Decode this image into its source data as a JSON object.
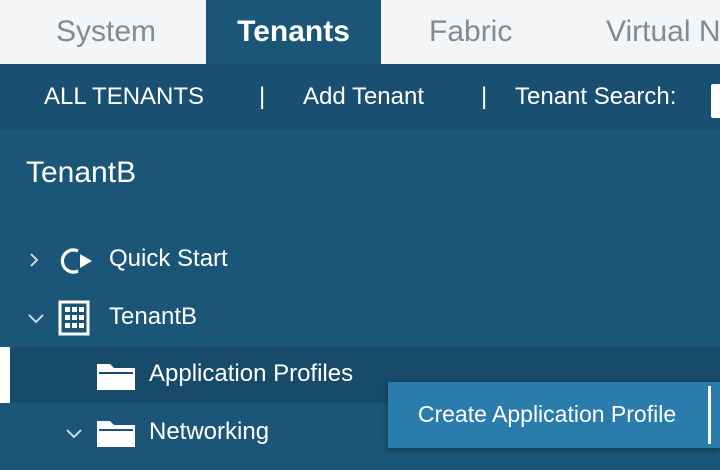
{
  "tabs": [
    {
      "label": "System"
    },
    {
      "label": "Tenants",
      "active": true
    },
    {
      "label": "Fabric"
    },
    {
      "label": "Virtual N"
    }
  ],
  "subnav": {
    "all_tenants": "ALL TENANTS",
    "sep": "|",
    "add_tenant": "Add Tenant",
    "tenant_search": "Tenant Search:"
  },
  "tenant_title": "TenantB",
  "tree": [
    {
      "label": "Quick Start",
      "icon": "quick-start-icon",
      "expanded": false
    },
    {
      "label": "TenantB",
      "icon": "building-icon",
      "expanded": true
    },
    {
      "label": "Application Profiles",
      "icon": "folder-icon",
      "selected": true
    },
    {
      "label": "Networking",
      "icon": "folder-icon",
      "expanded": true
    }
  ],
  "popup": {
    "create_label": "Create Application Profile"
  },
  "colors": {
    "primary": "#1b5577",
    "tab_bar": "#f3f5f7",
    "popup": "#2a7cad"
  }
}
